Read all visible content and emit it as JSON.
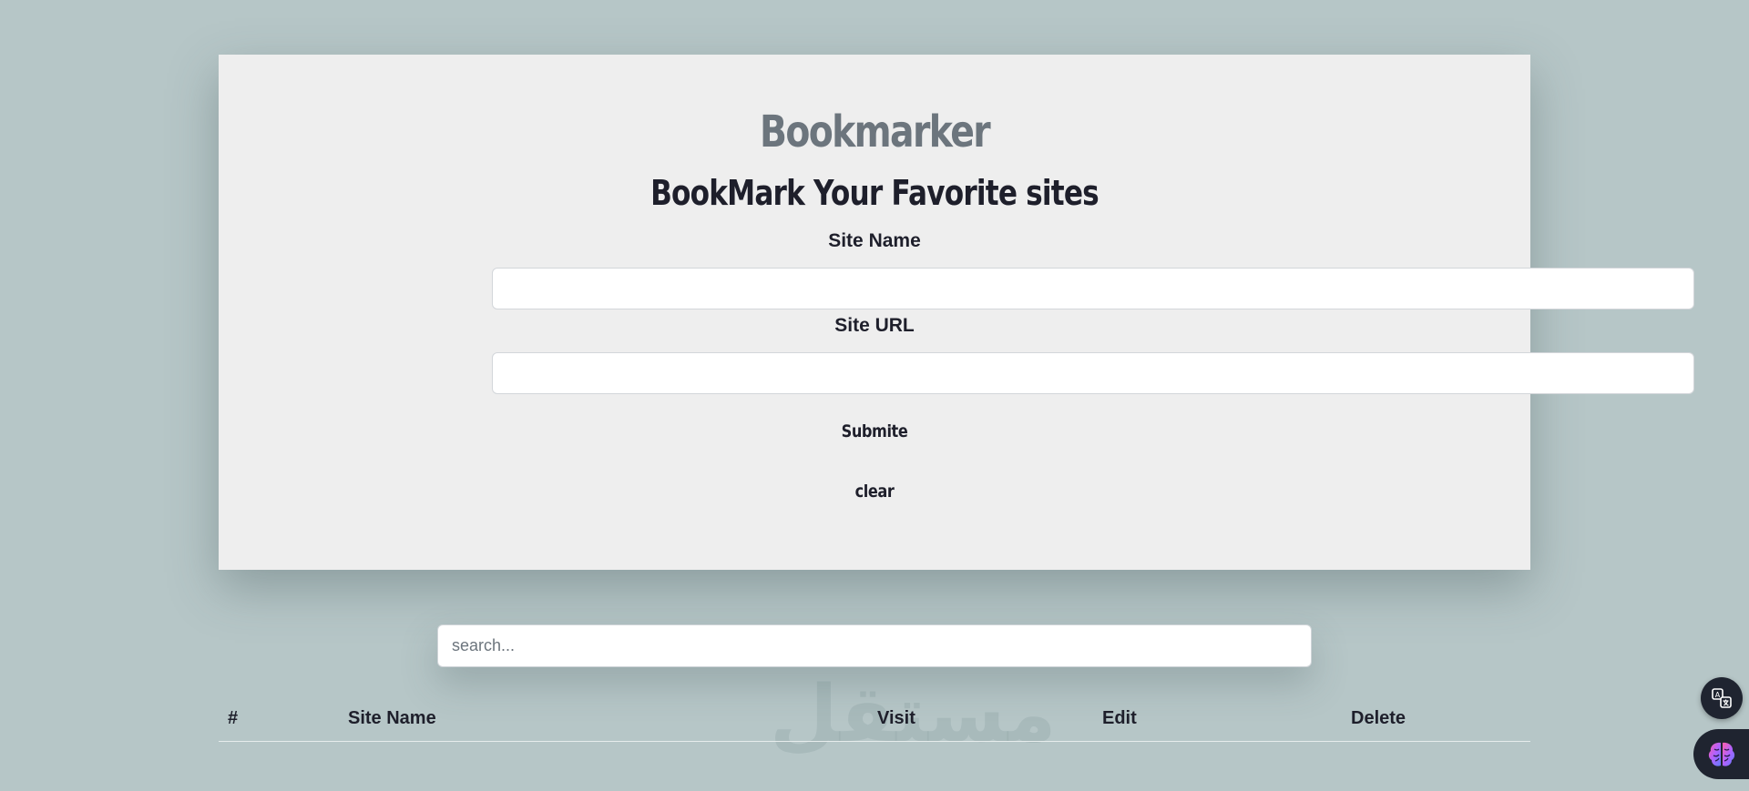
{
  "header": {
    "brand": "Bookmarker",
    "subtitle": "BookMark Your Favorite sites"
  },
  "form": {
    "site_name_label": "Site Name",
    "site_url_label": "Site URL",
    "submit_label": "Submite",
    "clear_label": "clear"
  },
  "search": {
    "placeholder": "search..."
  },
  "table": {
    "headers": [
      "#",
      "Site Name",
      "Visit",
      "Edit",
      "Delete"
    ]
  },
  "watermark": "مستقل",
  "icons": {
    "translate": "translate-icon",
    "assistant": "brain-icon"
  },
  "colors": {
    "background": "#b6c6c7",
    "card": "#eeeeee",
    "brand": "#6c757d",
    "text": "#1e1f2b"
  }
}
